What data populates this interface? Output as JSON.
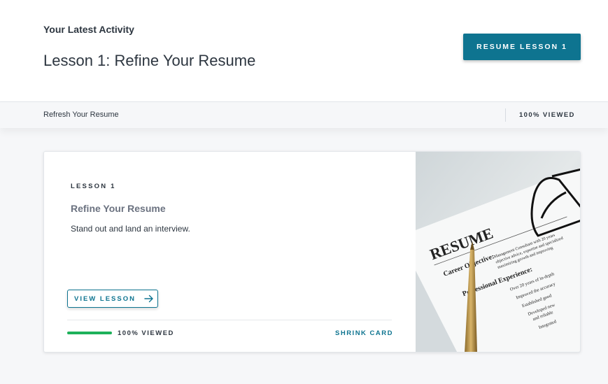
{
  "header": {
    "eyebrow": "Your Latest Activity",
    "title": "Lesson 1: Refine Your Resume",
    "resume_button": "RESUME LESSON 1"
  },
  "status_bar": {
    "course": "Refresh Your Resume",
    "viewed": "100% VIEWED"
  },
  "card": {
    "eyebrow": "LESSON 1",
    "title": "Refine Your Resume",
    "description": "Stand out and land an interview.",
    "view_button": "VIEW LESSON",
    "progress_fraction": 1.0,
    "viewed": "100% VIEWED",
    "shrink": "SHRINK CARD",
    "image": {
      "heading": "RESUME",
      "section1": "Career Objective:",
      "section2": "Professional Experience:",
      "text1": "Management Consultant with 20 years",
      "text2": "objective advice, expertise and specialized",
      "text3": "maximizing growth and improving",
      "bullet1": "Over 20 years of in-depth",
      "bullet2": "Improved the accuracy",
      "bullet3": "Established good",
      "bullet4": "Developed new",
      "bullet5": "and reliable",
      "bullet6": "Integrated"
    }
  },
  "colors": {
    "accent": "#0e7490",
    "progress": "#1eb15a",
    "text": "#2d3640"
  }
}
